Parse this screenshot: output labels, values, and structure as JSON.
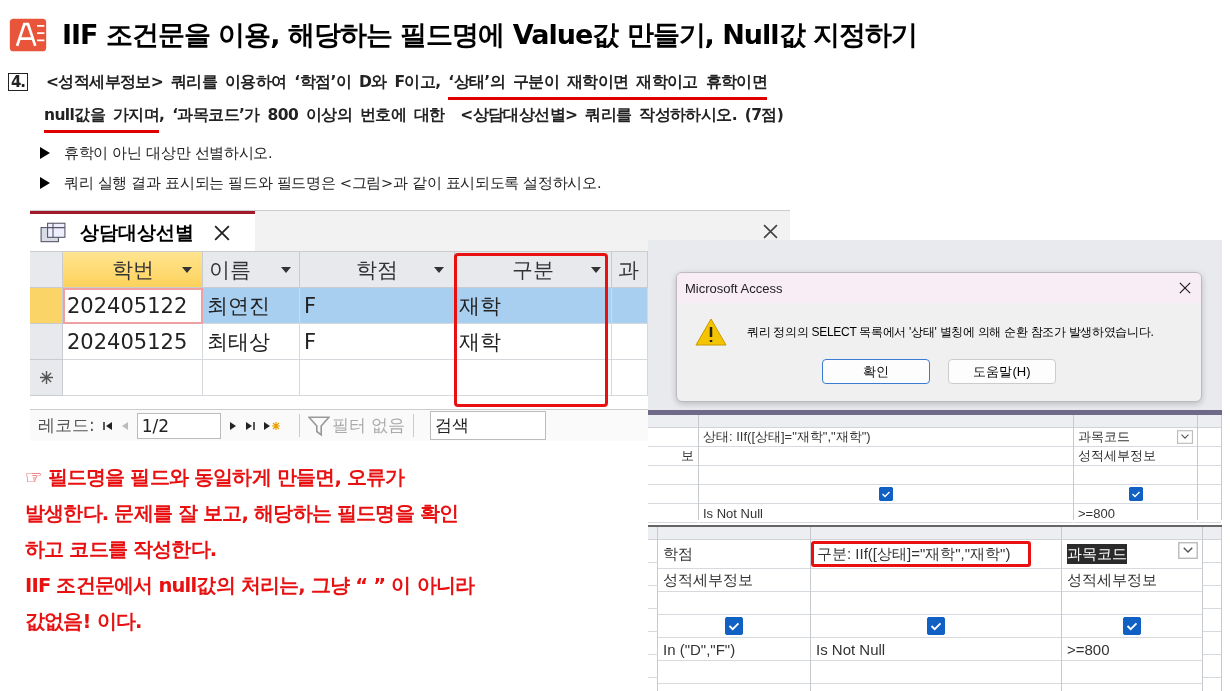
{
  "title": "IIF 조건문을 이용, 해당하는 필드명에 Value값 만들기, Null값 지정하기",
  "question": {
    "number": "4.",
    "lines": [
      [
        {
          "text": "<성적세부정보> 쿼리를 이용하여 ‘학점’이 D와 F이고, ",
          "underlined": false
        },
        {
          "text": "‘상태’의 구분이 재학이면 재학이고 휴학이면",
          "underlined": true
        }
      ],
      [
        {
          "text": "null값을 가지며",
          "underlined": true
        },
        {
          "text": ", ‘과목코드’가 800 이상의 번호에 대한  <상담대상선별> 쿼리를 작성하하시오. (7점)",
          "underlined": false
        }
      ]
    ],
    "bullets": [
      "휴학이 아닌 대상만 선별하시오.",
      "쿼리 실행 결과 표시되는 필드와 필드명은 <그림>과 같이 표시되도록 설정하시오."
    ]
  },
  "datasheet": {
    "tab": "상담대상선별",
    "columns": [
      {
        "label": "학번",
        "selected": true,
        "highlighted": false
      },
      {
        "label": "이름",
        "selected": false,
        "highlighted": false
      },
      {
        "label": "학점",
        "selected": false,
        "highlighted": false
      },
      {
        "label": "구분",
        "selected": false,
        "highlighted": true
      },
      {
        "label": "과",
        "selected": false,
        "highlighted": false
      }
    ],
    "rows": [
      {
        "selected": true,
        "cells": [
          "202405122",
          "최연진",
          "F",
          "재학"
        ]
      },
      {
        "selected": false,
        "cells": [
          "202405125",
          "최태상",
          "F",
          "재학"
        ]
      }
    ],
    "nav": {
      "label": "레코드:",
      "position": "1/2",
      "filter": "필터 없음",
      "search": "검색"
    }
  },
  "dialog": {
    "title": "Microsoft Access",
    "message": "쿼리 정의의 SELECT 목록에서 '상태' 별칭에 의해 순환 참조가 발생하였습니다.",
    "buttons": [
      {
        "label": "확인",
        "selected": true
      },
      {
        "label": "도움말(H)",
        "selected": false
      }
    ]
  },
  "design_grid_before": {
    "columns": [
      {
        "table": "보"
      },
      {
        "field": "상태: IIf([상태]=\"재학\",\"재학\")",
        "show": true,
        "criteria": "Is Not Null"
      },
      {
        "field": "과목코드",
        "table": "성적세부정보",
        "show": true,
        "criteria": ">=800",
        "dropdown": true
      }
    ]
  },
  "design_grid_after": {
    "columns": [
      {
        "field": "학점",
        "table": "성적세부정보",
        "show": true,
        "criteria": "In (\"D\",\"F\")"
      },
      {
        "field": "구분: IIf([상태]=\"재학\",\"재학\")",
        "show": true,
        "criteria": "Is Not Null",
        "highlighted": true
      },
      {
        "field": "과목코드",
        "table": "성적세부정보",
        "show": true,
        "criteria": ">=800",
        "selected_text": true,
        "dropdown": true
      }
    ]
  },
  "note": [
    "☞ 필드명을 필드와 동일하게 만들면, 오류가",
    "발생한다. 문제를 잘 보고, 해당하는 필드명을 확인",
    "하고 코드를 작성한다.",
    "IIF 조건문에서 null값의 처리는, 그냥 “ ” 이 아니라",
    "값없음! 이다."
  ]
}
